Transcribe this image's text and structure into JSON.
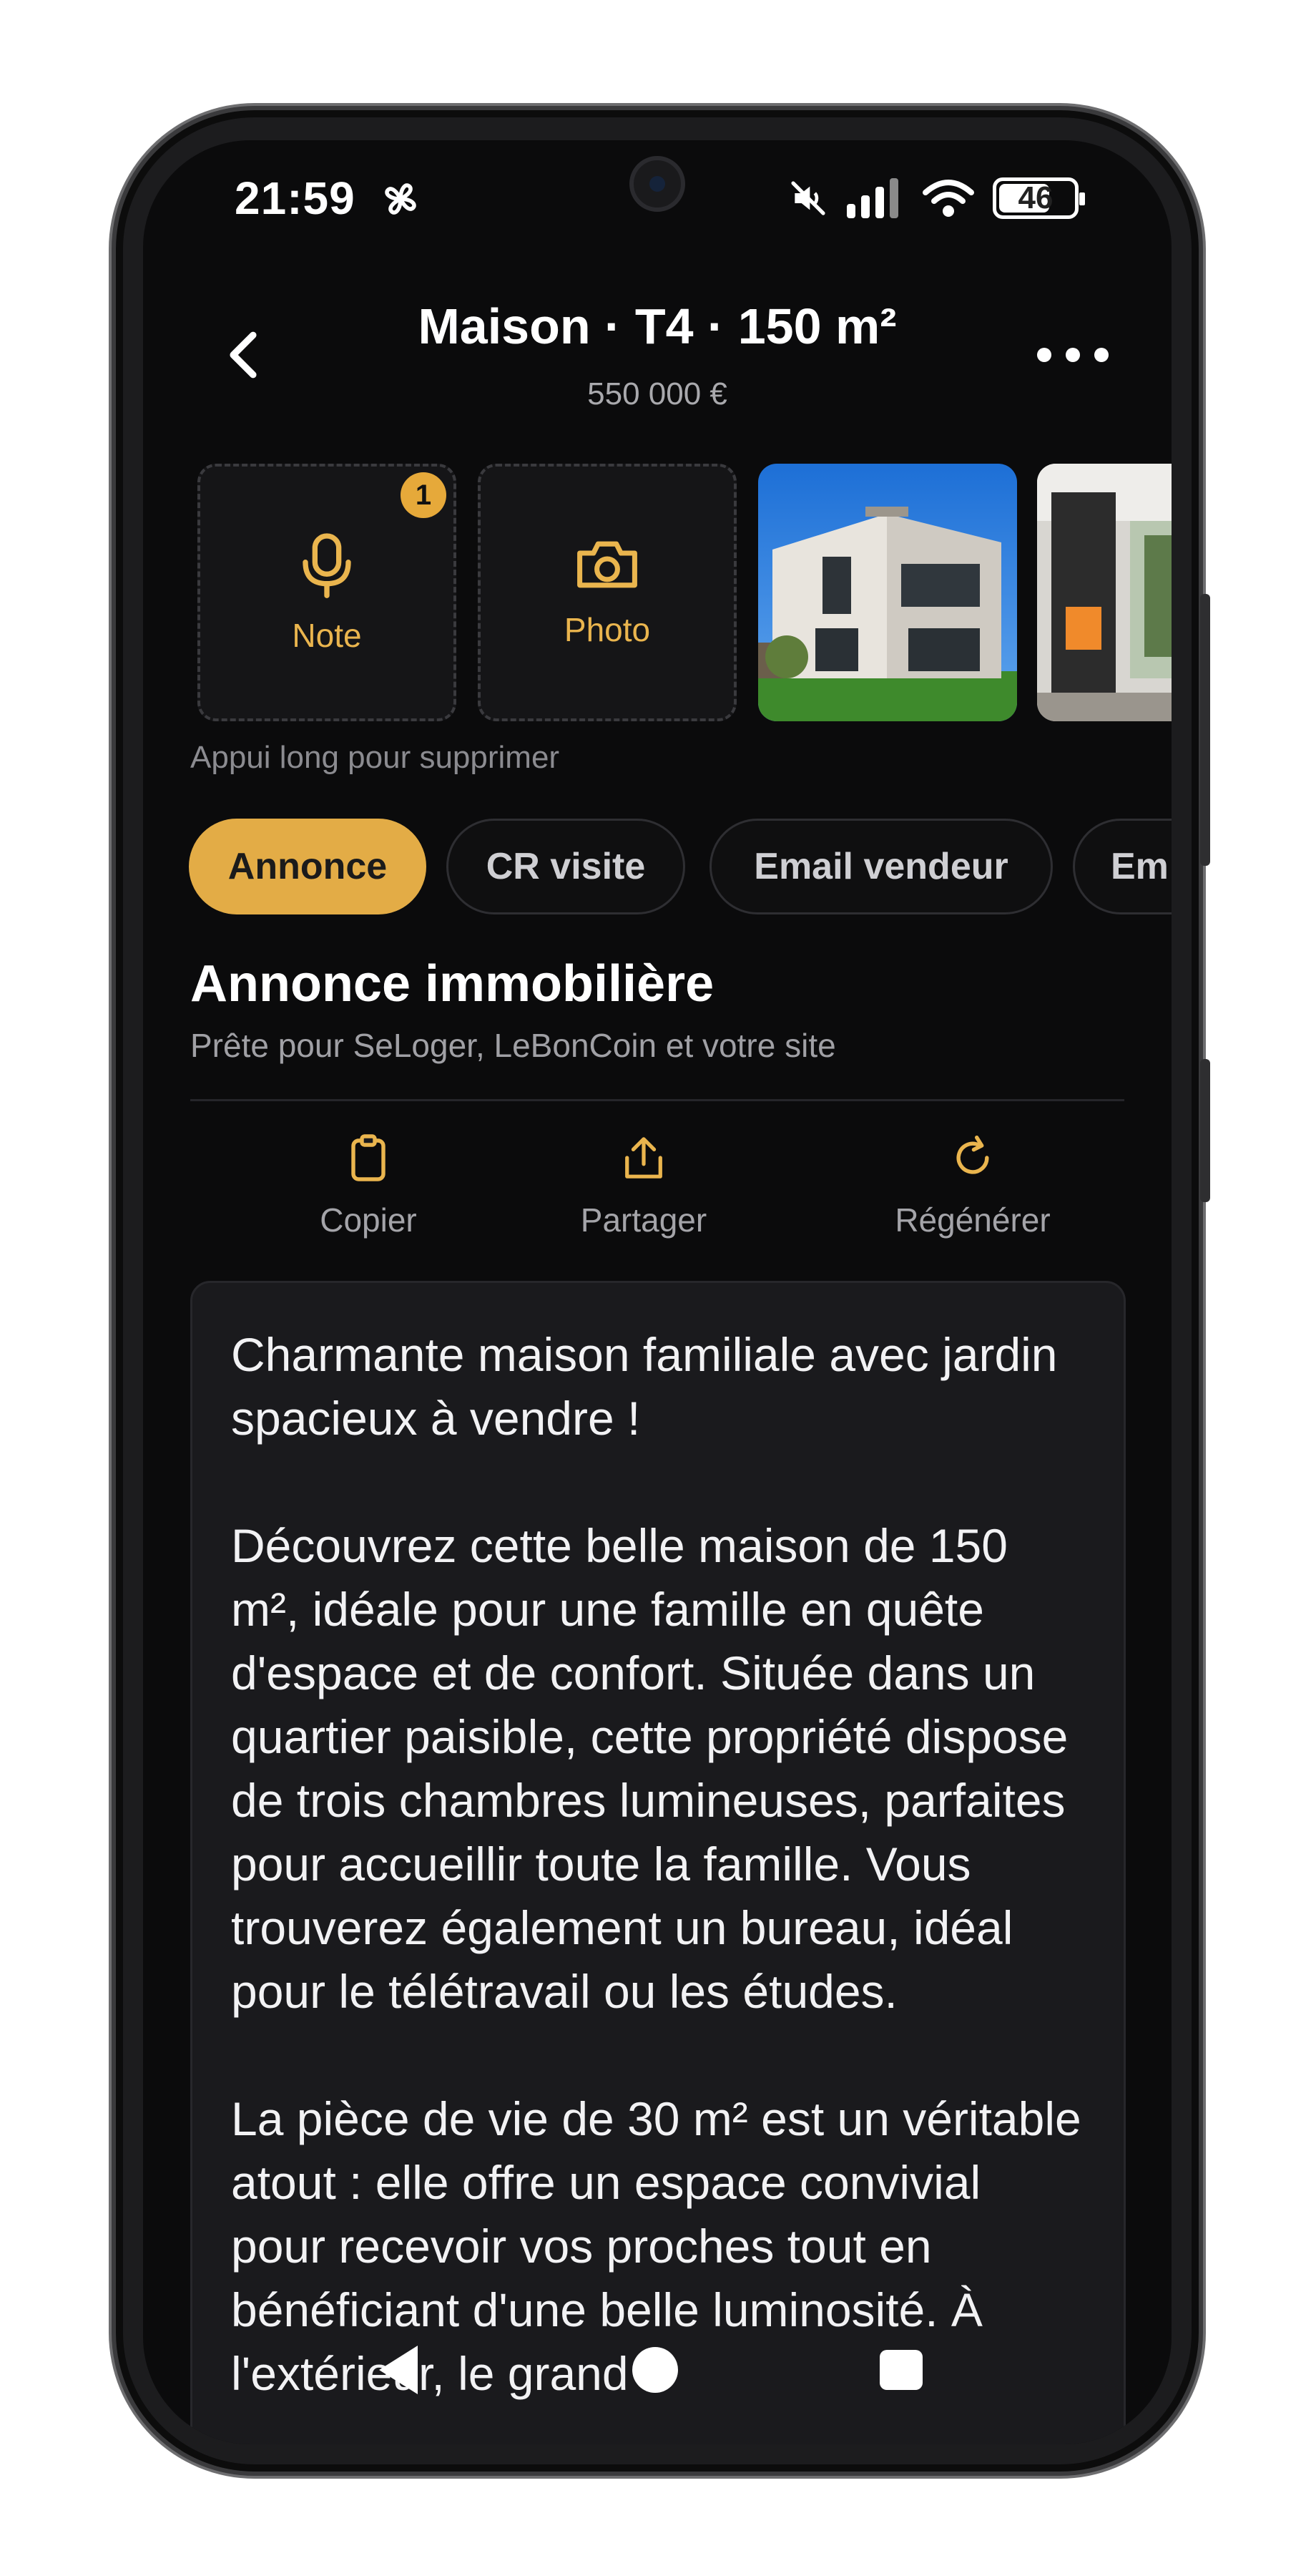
{
  "status_bar": {
    "time": "21:59",
    "battery": "46",
    "icons": [
      "fan-icon",
      "mute-icon",
      "signal-icon",
      "wifi-icon",
      "battery-icon"
    ]
  },
  "header": {
    "title": "Maison · T4 · 150 m²",
    "price": "550 000 €"
  },
  "media": {
    "note_label": "Note",
    "note_badge": "1",
    "photo_label": "Photo",
    "hint": "Appui long pour supprimer"
  },
  "tabs": [
    {
      "label": "Annonce",
      "active": true
    },
    {
      "label": "CR visite",
      "active": false
    },
    {
      "label": "Email vendeur",
      "active": false
    },
    {
      "label": "Em",
      "active": false
    }
  ],
  "section": {
    "title": "Annonce immobilière",
    "subtitle": "Prête pour SeLoger, LeBonCoin et votre site"
  },
  "actions": {
    "copy": "Copier",
    "share": "Partager",
    "regenerate": "Régénérer"
  },
  "listing_text": {
    "p1": "Charmante maison familiale avec jardin spacieux à vendre !",
    "p2": "Découvrez cette belle maison de 150 m², idéale pour une famille en quête d'espace et de confort. Située dans un quartier paisible, cette propriété dispose de trois chambres lumineuses, parfaites pour accueillir toute la famille. Vous trouverez également un bureau, idéal pour le télétravail ou les études.",
    "p3": "La pièce de vie de 30 m² est un véritable atout : elle offre un espace convivial pour recevoir vos proches tout en bénéficiant d'une belle luminosité. À l'extérieur, le grand"
  },
  "colors": {
    "accent": "#e3ac46",
    "background": "#0b0b0c",
    "card": "#1a1a1d"
  }
}
